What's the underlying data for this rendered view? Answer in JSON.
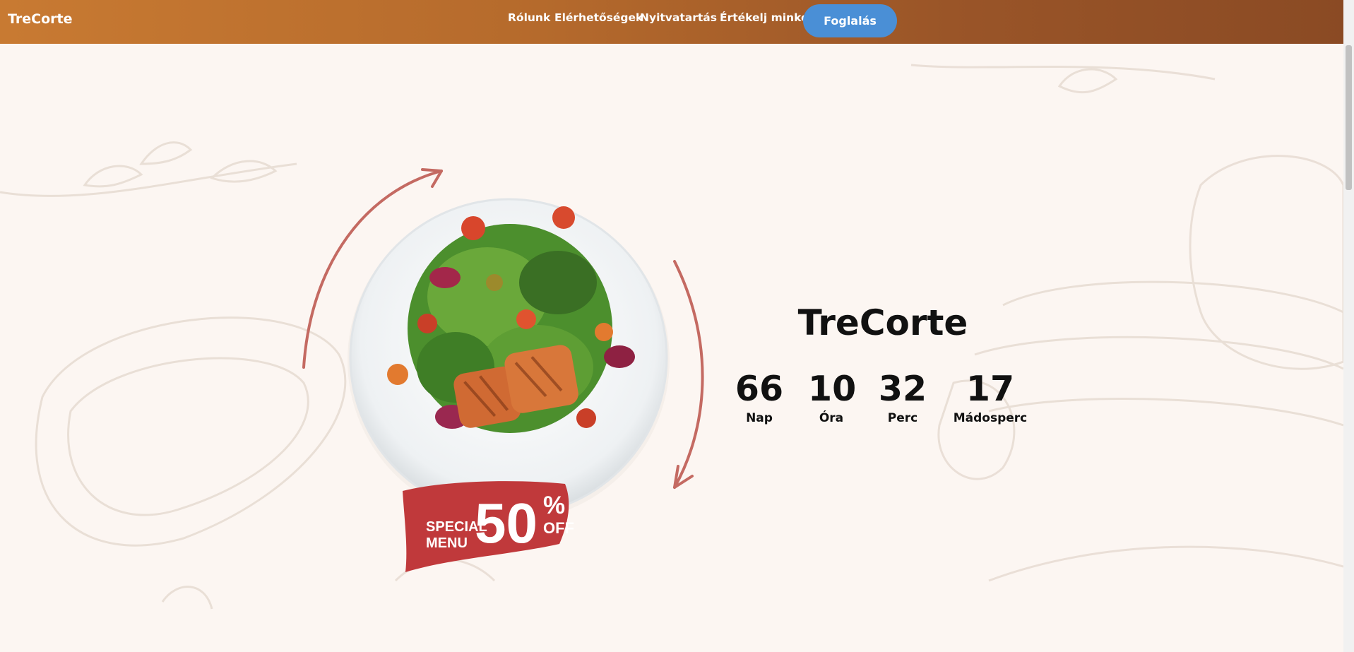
{
  "navbar": {
    "brand": "TreCorte",
    "links": [
      "Rólunk",
      "Elérhetőségek",
      "Nyitvatartás",
      "Értékelj minket"
    ],
    "cta": "Foglalás"
  },
  "hero": {
    "title": "TreCorte",
    "promo": {
      "line1": "SPECIAL",
      "line2": "MENU",
      "value": "50",
      "percent": "%",
      "off": "OFF"
    },
    "countdown": [
      {
        "value": "66",
        "label": "Nap"
      },
      {
        "value": "10",
        "label": "Óra"
      },
      {
        "value": "32",
        "label": "Perc"
      },
      {
        "value": "17",
        "label": "Mádosperc"
      }
    ]
  },
  "colors": {
    "nav_start": "#c87a32",
    "nav_end": "#8a4a24",
    "cta": "#4a8fd6",
    "promo": "#c0393b",
    "background": "#fcf6f2"
  }
}
